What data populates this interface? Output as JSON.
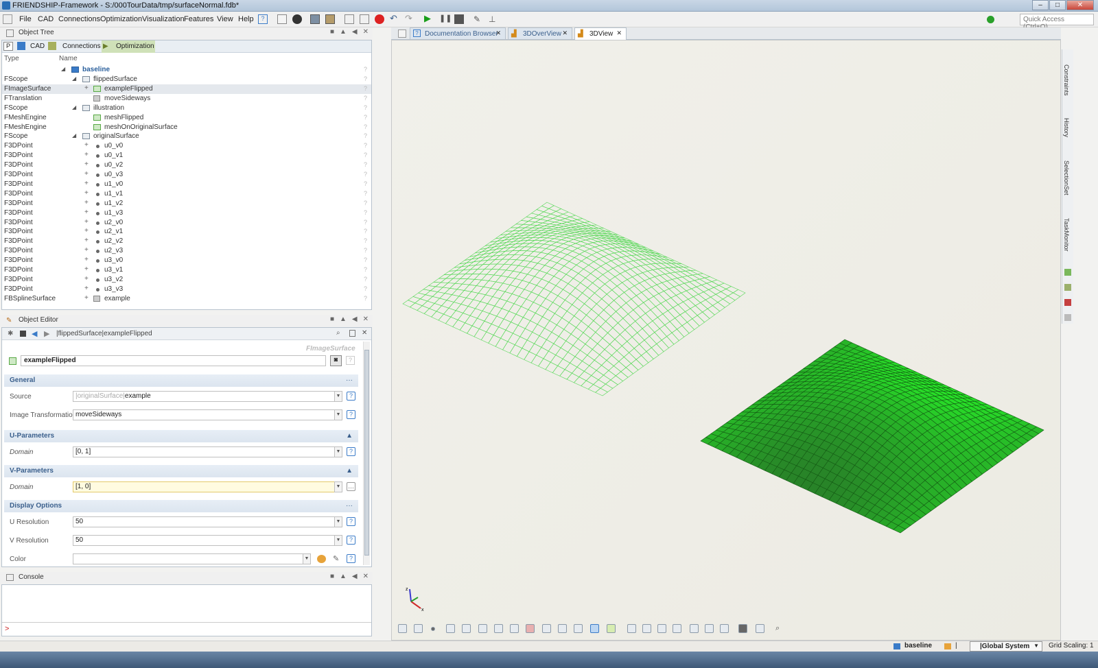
{
  "window": {
    "title": "FRIENDSHIP-Framework - S:/000TourData/tmp/surfaceNormal.fdb*"
  },
  "menu": [
    "File",
    "CAD",
    "Connections",
    "Optimization",
    "Visualization",
    "Features",
    "View",
    "Help"
  ],
  "quick_access": {
    "placeholder": "Quick Access (Ctrl+Q)"
  },
  "object_tree": {
    "title": "Object Tree",
    "tabs": [
      "P",
      "CAD",
      "Connections",
      "Optimization"
    ],
    "columns": {
      "type": "Type",
      "name": "Name"
    },
    "root": "baseline",
    "rows": [
      {
        "type": "FScope",
        "name": "flippedSurface"
      },
      {
        "type": "FImageSurface",
        "name": "exampleFlipped"
      },
      {
        "type": "FTranslation",
        "name": "moveSideways"
      },
      {
        "type": "FScope",
        "name": "illustration"
      },
      {
        "type": "FMeshEngine",
        "name": "meshFlipped"
      },
      {
        "type": "FMeshEngine",
        "name": "meshOnOriginalSurface"
      },
      {
        "type": "FScope",
        "name": "originalSurface"
      },
      {
        "type": "F3DPoint",
        "name": "u0_v0"
      },
      {
        "type": "F3DPoint",
        "name": "u0_v1"
      },
      {
        "type": "F3DPoint",
        "name": "u0_v2"
      },
      {
        "type": "F3DPoint",
        "name": "u0_v3"
      },
      {
        "type": "F3DPoint",
        "name": "u1_v0"
      },
      {
        "type": "F3DPoint",
        "name": "u1_v1"
      },
      {
        "type": "F3DPoint",
        "name": "u1_v2"
      },
      {
        "type": "F3DPoint",
        "name": "u1_v3"
      },
      {
        "type": "F3DPoint",
        "name": "u2_v0"
      },
      {
        "type": "F3DPoint",
        "name": "u2_v1"
      },
      {
        "type": "F3DPoint",
        "name": "u2_v2"
      },
      {
        "type": "F3DPoint",
        "name": "u2_v3"
      },
      {
        "type": "F3DPoint",
        "name": "u3_v0"
      },
      {
        "type": "F3DPoint",
        "name": "u3_v1"
      },
      {
        "type": "F3DPoint",
        "name": "u3_v2"
      },
      {
        "type": "F3DPoint",
        "name": "u3_v3"
      },
      {
        "type": "FBSplineSurface",
        "name": "example"
      }
    ]
  },
  "object_editor": {
    "title": "Object Editor",
    "breadcrumb": "|flippedSurface|exampleFlipped",
    "type_label": "FImageSurface",
    "object_name": "exampleFlipped",
    "sections": {
      "general": "General",
      "u_params": "U-Parameters",
      "v_params": "V-Parameters",
      "display": "Display Options"
    },
    "source": {
      "label": "Source",
      "prefix": "|originalSurface|",
      "value": "example"
    },
    "image_transformation": {
      "label": "Image Transformation",
      "value": "moveSideways"
    },
    "u_domain": {
      "label": "Domain",
      "value": "[0, 1]"
    },
    "v_domain": {
      "label": "Domain",
      "value": "[1, 0]"
    },
    "u_resolution": {
      "label": "U Resolution",
      "value": "50"
    },
    "v_resolution": {
      "label": "V Resolution",
      "value": "50"
    },
    "color": {
      "label": "Color",
      "value": ""
    }
  },
  "console": {
    "title": "Console",
    "prompt": ">"
  },
  "view_tabs": [
    "Documentation Browser",
    "3DOverView",
    "3DView"
  ],
  "right_side_tabs": [
    "Constraints",
    "History",
    "SelectionSet",
    "TaskMonitor"
  ],
  "status": {
    "scope": "baseline",
    "sep": "|",
    "system": "|Global System",
    "grid": "Grid Scaling: 1"
  },
  "colors": {
    "accent": "#3a7bc8",
    "surface_fill": "#3ec83a",
    "wire": "#58d858"
  }
}
